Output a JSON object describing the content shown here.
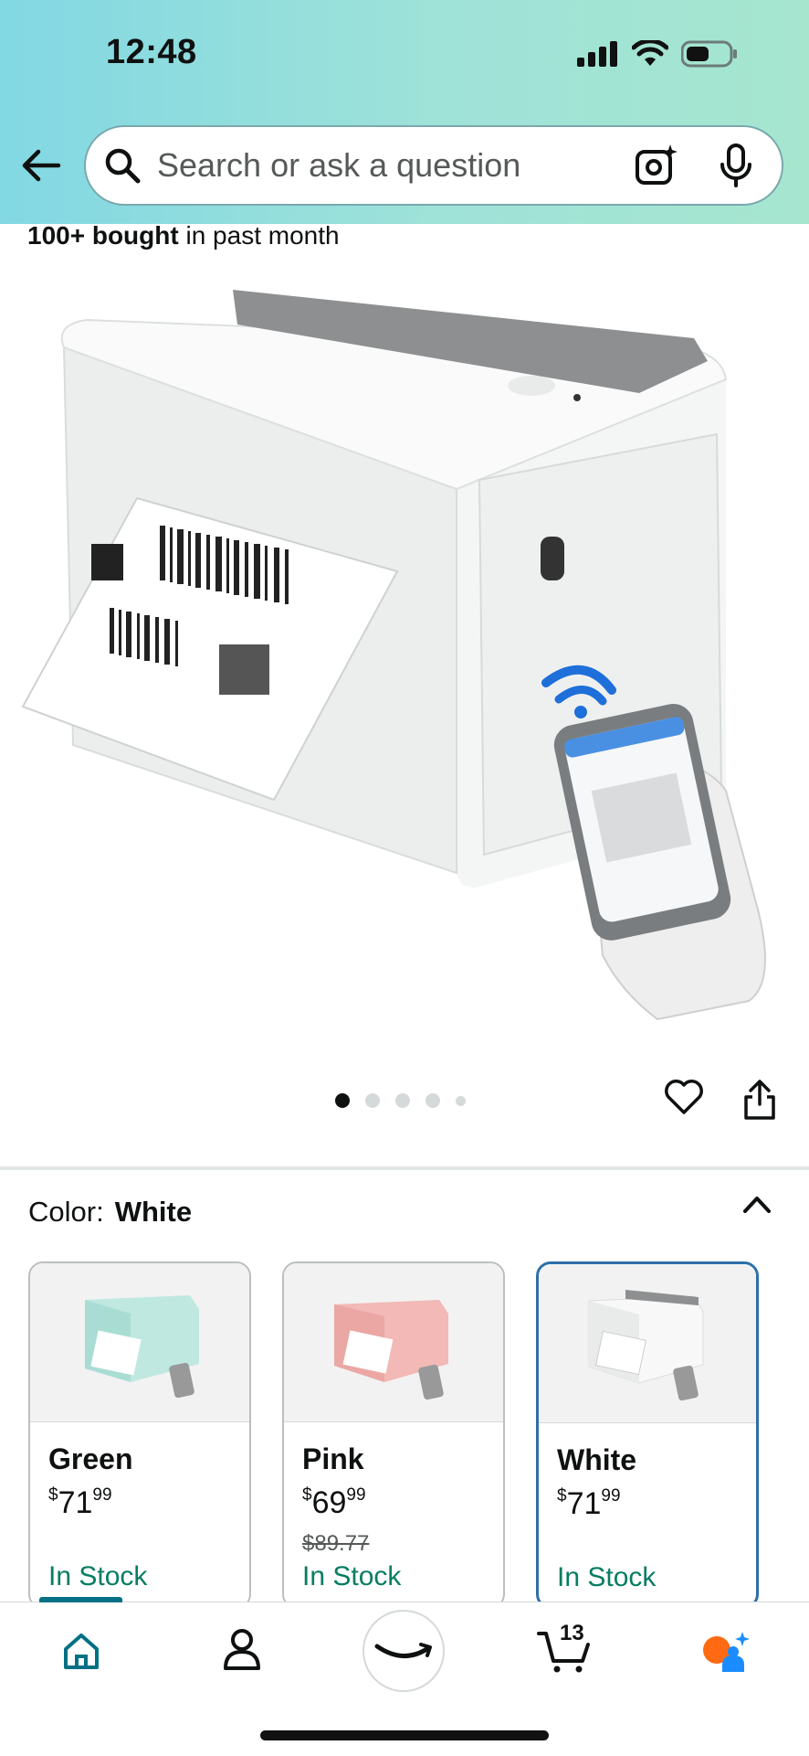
{
  "status_bar": {
    "time": "12:48"
  },
  "search": {
    "placeholder": "Search or ask a question"
  },
  "product": {
    "bought_count": "100+ bought",
    "bought_suffix": " in past month",
    "gallery": {
      "total_images": 5,
      "active_index": 0
    }
  },
  "variation": {
    "label": "Color:",
    "selected": "White",
    "options": [
      {
        "name": "Green",
        "price_whole": "71",
        "price_cents": "99",
        "currency": "$",
        "list_price": "",
        "stock": "In Stock",
        "color": "#bfe8e1"
      },
      {
        "name": "Pink",
        "price_whole": "69",
        "price_cents": "99",
        "currency": "$",
        "list_price": "$89.77",
        "stock": "In Stock",
        "color": "#f2b9b6"
      },
      {
        "name": "White",
        "price_whole": "71",
        "price_cents": "99",
        "currency": "$",
        "list_price": "",
        "stock": "In Stock",
        "color": "#f0f0f0"
      }
    ]
  },
  "bottom_nav": {
    "items": [
      "home-icon",
      "account-icon",
      "amazon-icon",
      "cart-icon",
      "rufus-icon"
    ],
    "cart_count": "13",
    "active": "home"
  },
  "colors": {
    "accent": "#007185",
    "stock_green": "#067d62",
    "selected_border": "#2d6fa8"
  }
}
